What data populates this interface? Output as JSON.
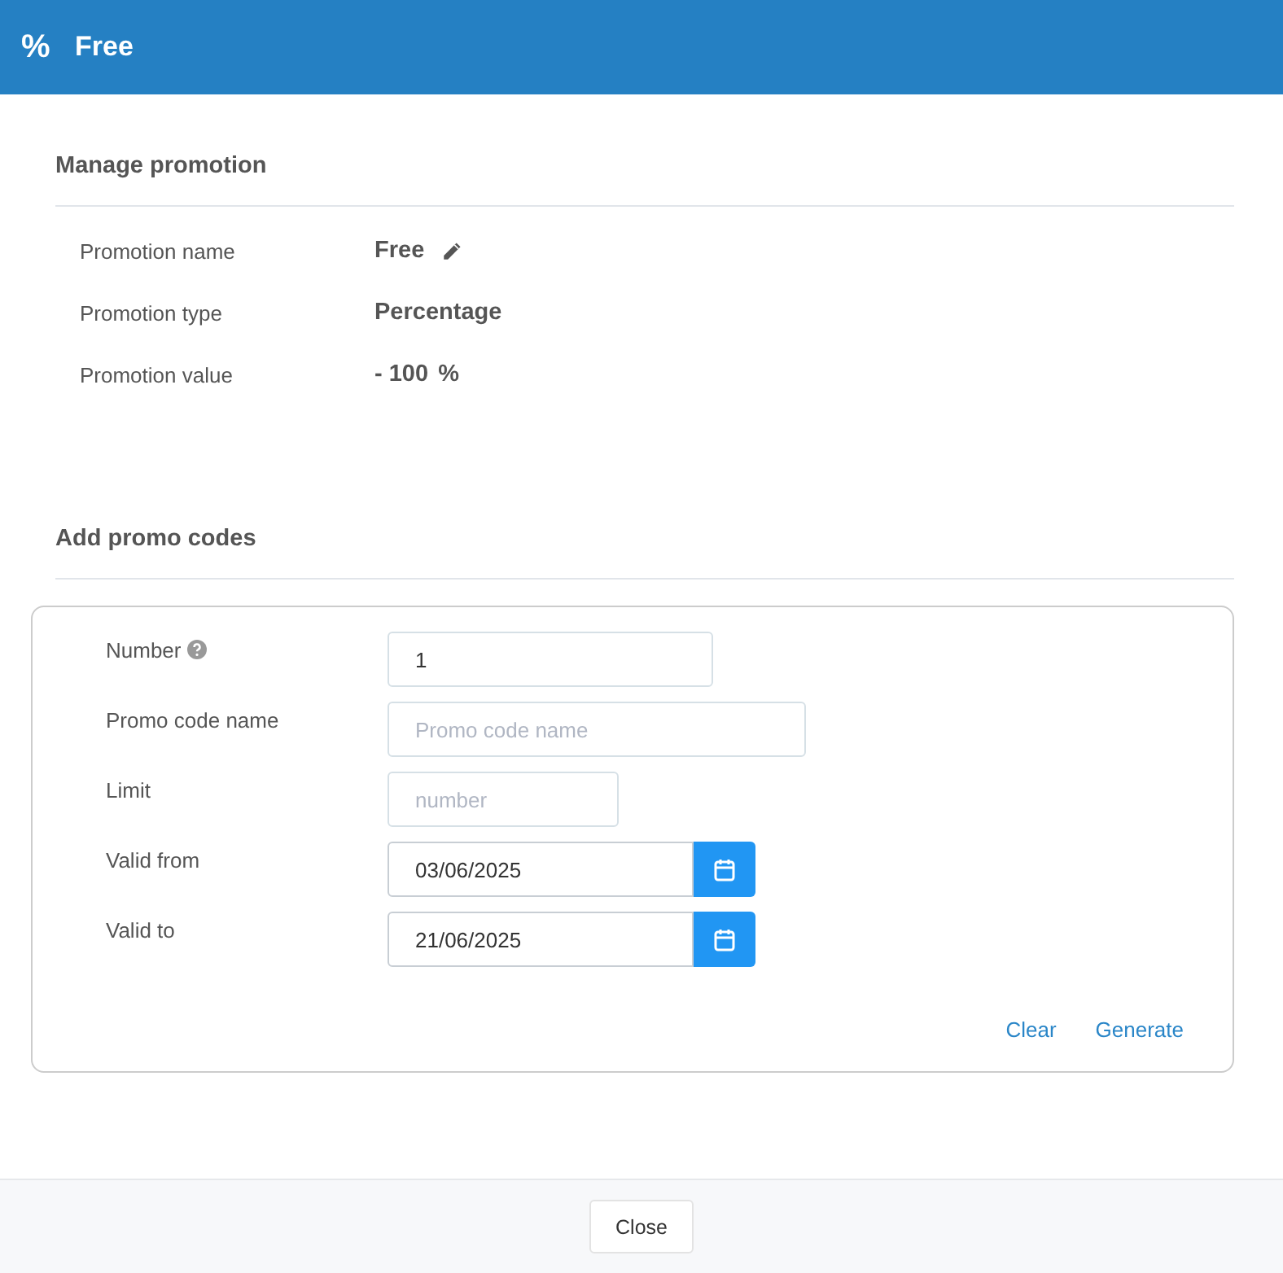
{
  "header": {
    "icon": "%",
    "title": "Free"
  },
  "manage": {
    "title": "Manage promotion",
    "rows": [
      {
        "label": "Promotion name",
        "value": "Free",
        "editable": true
      },
      {
        "label": "Promotion type",
        "value": "Percentage",
        "editable": false
      },
      {
        "label": "Promotion value",
        "value": "- 100",
        "unit": "%",
        "editable": false
      }
    ]
  },
  "codes": {
    "title": "Add promo codes",
    "fields": [
      {
        "kind": "count",
        "label": "Number",
        "help": true,
        "value": "1"
      },
      {
        "kind": "text",
        "label": "Promo code name",
        "help": false,
        "placeholder": "Promo code name"
      },
      {
        "kind": "short",
        "label": "Limit",
        "help": false,
        "placeholder": "number"
      },
      {
        "kind": "date",
        "label": "Valid from",
        "help": false,
        "value": "03/06/2025"
      },
      {
        "kind": "date",
        "label": "Valid to",
        "help": false,
        "value": "21/06/2025"
      }
    ],
    "actions": [
      "Clear",
      "Generate"
    ]
  },
  "footer": {
    "button": "Close"
  }
}
